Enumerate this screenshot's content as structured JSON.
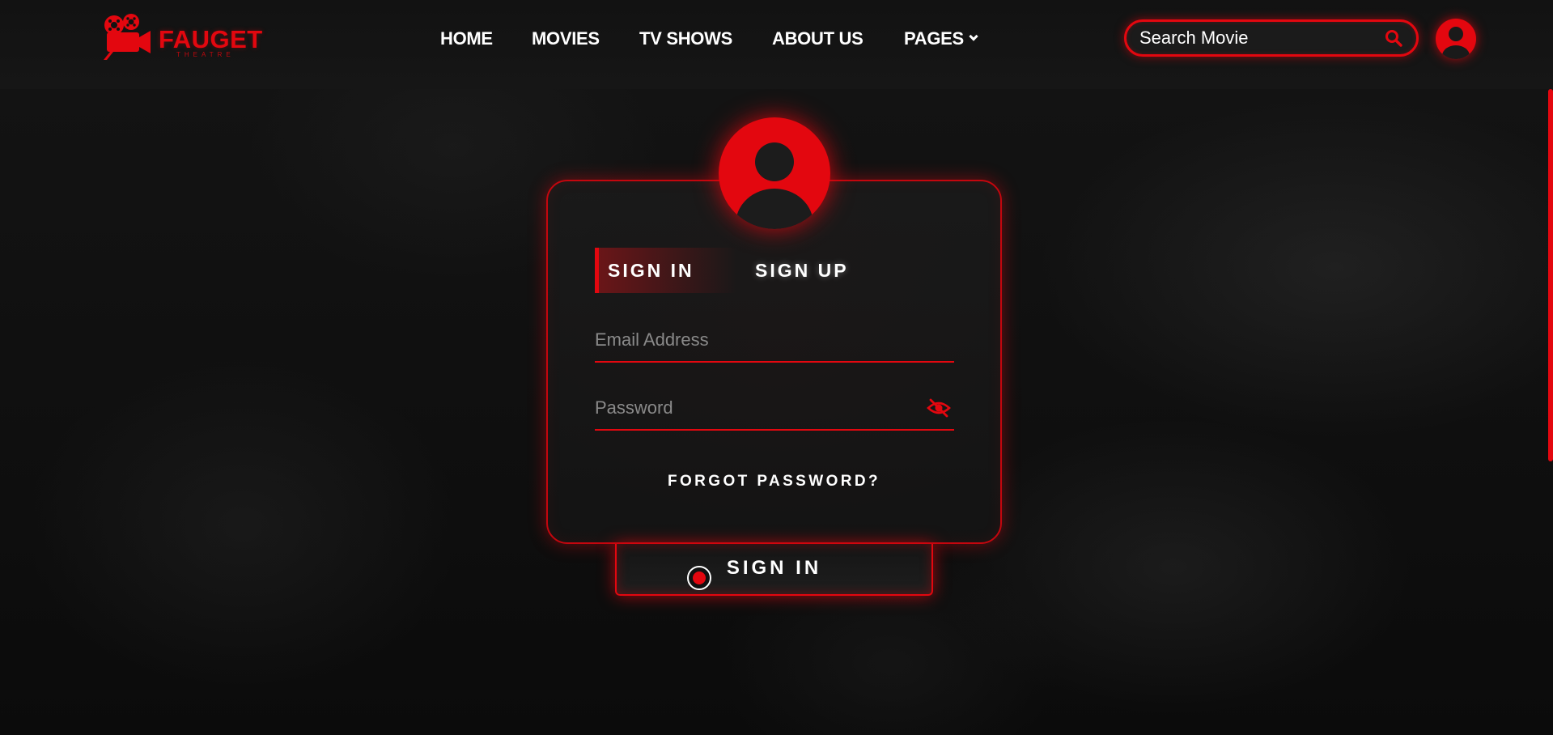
{
  "brand": {
    "name": "FAUGET",
    "tagline": "THEATRE",
    "accent_color": "#e3070f",
    "logo_icon": "film-camera-icon"
  },
  "nav": {
    "items": [
      {
        "label": "HOME"
      },
      {
        "label": "MOVIES"
      },
      {
        "label": "TV SHOWS"
      },
      {
        "label": "ABOUT US"
      },
      {
        "label": "PAGES",
        "has_dropdown": true
      }
    ]
  },
  "search": {
    "placeholder": "Search Movie",
    "icon": "search-icon"
  },
  "user": {
    "avatar_icon": "user-avatar-icon"
  },
  "auth": {
    "tabs": [
      {
        "label": "SIGN IN",
        "active": true
      },
      {
        "label": "SIGN UP",
        "active": false
      }
    ],
    "email_placeholder": "Email Address",
    "password_placeholder": "Password",
    "password_toggle_icon": "eye-slash-icon",
    "forgot_label": "FORGOT PASSWORD?",
    "submit_label": "SIGN IN"
  }
}
